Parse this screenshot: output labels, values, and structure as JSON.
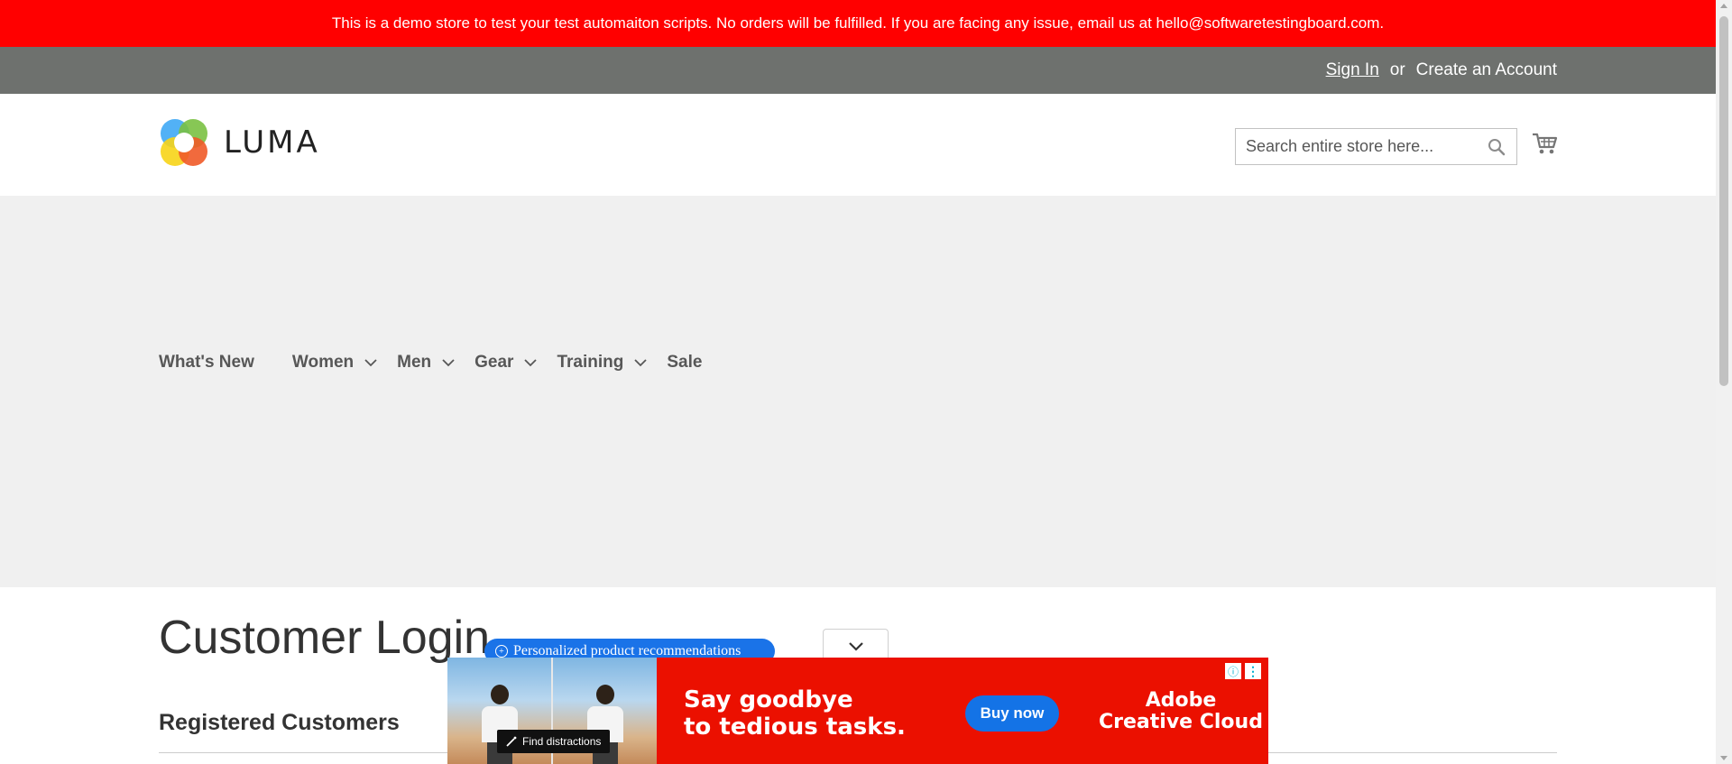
{
  "demo_banner": {
    "text": "This is a demo store to test your test automaiton scripts. No orders will be fulfilled. If you are facing any issue, email us at hello@softwaretestingboard.com."
  },
  "header": {
    "sign_in": "Sign In",
    "or": "or",
    "create_account": "Create an Account",
    "logo_text": "LUMA",
    "search_placeholder": "Search entire store here...",
    "search_value": "",
    "search_icon": "search-icon",
    "cart_icon": "cart-icon"
  },
  "nav": {
    "items": [
      {
        "label": "What's New",
        "has_submenu": false
      },
      {
        "label": "Women",
        "has_submenu": true
      },
      {
        "label": "Men",
        "has_submenu": true
      },
      {
        "label": "Gear",
        "has_submenu": true
      },
      {
        "label": "Training",
        "has_submenu": true
      },
      {
        "label": "Sale",
        "has_submenu": false
      }
    ]
  },
  "main": {
    "page_title": "Customer Login",
    "section_title": "Registered Customers"
  },
  "overlay": {
    "recommendations_label": "Personalized product recommendations",
    "collapse_icon": "chevron-down-icon"
  },
  "ad": {
    "find_distractions": "Find distractions",
    "headline_line1": "Say goodbye",
    "headline_line2": "to tedious tasks.",
    "buy_label": "Buy now",
    "brand_line1": "Adobe",
    "brand_line2": "Creative Cloud",
    "colors": {
      "background": "#eb1000",
      "button": "#1473e6"
    }
  },
  "colors": {
    "banner": "#ff0000",
    "panel_header": "#6e716e",
    "nav_background": "#f0f0f0",
    "pill": "#1a73e8"
  }
}
